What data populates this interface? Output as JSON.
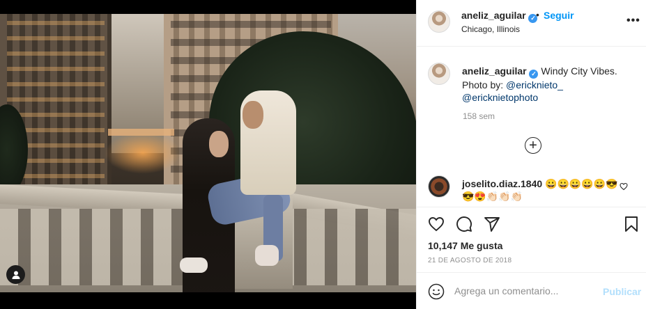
{
  "post": {
    "username": "aneliz_aguilar",
    "verified_mark": "✓",
    "separator": "•",
    "follow_label": "Seguir",
    "location": "Chicago, Illinois",
    "more_label": "•••",
    "caption": {
      "username": "aneliz_aguilar",
      "text": "Windy City Vibes. Photo by: ",
      "mention1": "@ericknieto_",
      "mention2": "@ericknietophoto"
    },
    "time_ago": "158 sem",
    "load_more_label": "+",
    "comment": {
      "username": "joselito.diaz.1840",
      "text": "😀😀😀😀😀😎😎😍👏🏻👏🏻👏🏻"
    },
    "likes": "10,147 Me gusta",
    "date": "21 DE AGOSTO DE 2018",
    "add_comment_placeholder": "Agrega un comentario...",
    "post_label": "Publicar"
  },
  "icons": {
    "verified": "verified-badge-icon",
    "more": "more-options-icon",
    "load_more": "plus-circle-icon",
    "heart": "heart-icon",
    "comment": "comment-icon",
    "share": "share-icon",
    "save": "bookmark-icon",
    "emoji": "smiley-icon",
    "tag": "user-tag-icon"
  },
  "colors": {
    "accent": "#0095f6",
    "verified": "#3897f0",
    "muted": "#8e8e8e",
    "post_disabled": "#b2dffc"
  }
}
